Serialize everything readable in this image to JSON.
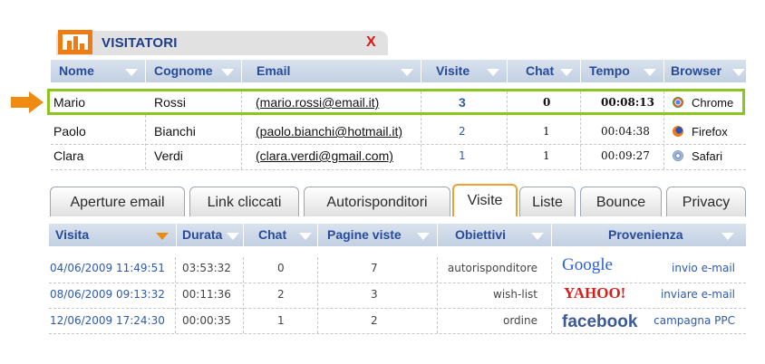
{
  "window": {
    "title": "VISITATORI",
    "close_label": "X"
  },
  "visitors": {
    "columns": [
      "Nome",
      "Cognome",
      "Email",
      "Visite",
      "Chat",
      "Tempo",
      "Browser"
    ],
    "rows": [
      {
        "nome": "Mario",
        "cognome": "Rossi",
        "email": "(mario.rossi@email.it)",
        "visite": "3",
        "chat": "0",
        "tempo": "00:08:13",
        "browser": "Chrome"
      },
      {
        "nome": "Paolo",
        "cognome": "Bianchi",
        "email": "(paolo.bianchi@hotmail.it)",
        "visite": "2",
        "chat": "1",
        "tempo": "00:04:38",
        "browser": "Firefox"
      },
      {
        "nome": "Clara",
        "cognome": "Verdi",
        "email": "(clara.verdi@gmail.com)",
        "visite": "1",
        "chat": "1",
        "tempo": "00:09:27",
        "browser": "Safari"
      }
    ]
  },
  "tabs": [
    "Aperture email",
    "Link cliccati",
    "Autorisponditori",
    "Visite",
    "Liste",
    "Bounce",
    "Privacy"
  ],
  "active_tab": "Visite",
  "visits": {
    "columns": [
      "Visita",
      "Durata",
      "Chat",
      "Pagine viste",
      "Obiettivi",
      "Provenienza"
    ],
    "rows": [
      {
        "visita": "04/06/2009 11:49:51",
        "durata": "03:53:32",
        "chat": "0",
        "pagine": "7",
        "obiettivo": "autorisponditore",
        "logo": "Google",
        "sorgente": "invio e-mail"
      },
      {
        "visita": "08/06/2009 09:13:32",
        "durata": "00:11:36",
        "chat": "2",
        "pagine": "3",
        "obiettivo": "wish-list",
        "logo": "YAHOO!",
        "sorgente": "inviare e-mail"
      },
      {
        "visita": "12/06/2009 17:24:30",
        "durata": "00:00:35",
        "chat": "1",
        "pagine": "2",
        "obiettivo": "ordine",
        "logo": "facebook",
        "sorgente": "campagna PPC"
      }
    ]
  },
  "colors": {
    "accent": "#ee7c12",
    "highlight": "#8cc51d",
    "header_text": "#274a9a"
  }
}
